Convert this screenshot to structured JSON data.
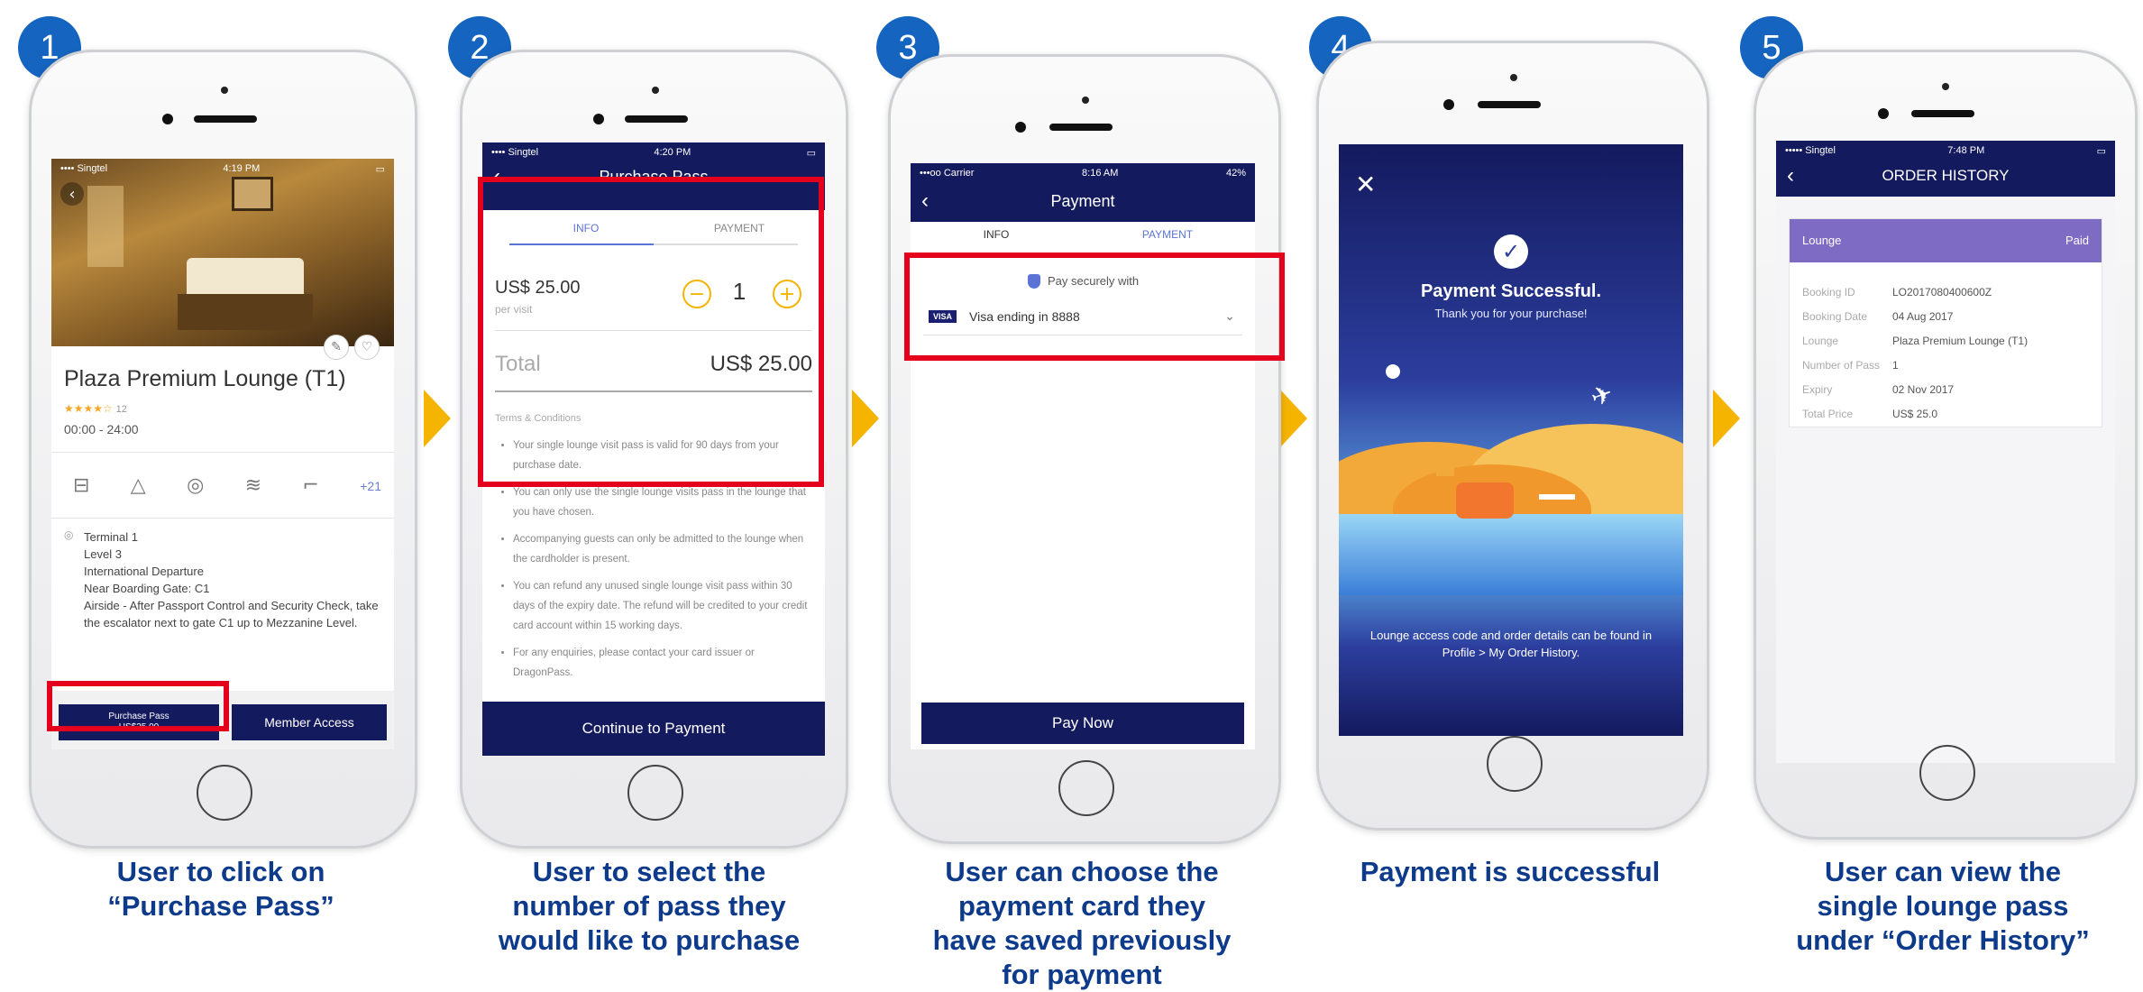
{
  "steps": [
    {
      "number": "1",
      "caption": [
        "User to click on",
        "“Purchase Pass”"
      ]
    },
    {
      "number": "2",
      "caption": [
        "User to select the",
        "number of pass they",
        "would like to purchase"
      ]
    },
    {
      "number": "3",
      "caption": [
        "User can choose the",
        "payment card they",
        "have saved previously",
        "for payment"
      ]
    },
    {
      "number": "4",
      "caption": [
        "Payment is successful"
      ]
    },
    {
      "number": "5",
      "caption": [
        "User can view the",
        "single lounge pass",
        "under “Order History”"
      ]
    }
  ],
  "screen1": {
    "status": {
      "carrier": "•••• Singtel",
      "time": "4:19 PM"
    },
    "lounge_name": "Plaza Premium Lounge (T1)",
    "rating_count": "12",
    "hours": "00:00 - 24:00",
    "amenities_more": "+21",
    "location_lines": [
      "Terminal 1",
      "Level 3",
      "International Departure",
      "Near Boarding Gate: C1",
      "Airside - After Passport Control and Security Check, take the escalator next to gate C1 up to Mezzanine Level."
    ],
    "purchase_label": "Purchase Pass",
    "purchase_price": "US$25.00",
    "member_label": "Member Access"
  },
  "screen2": {
    "status": {
      "carrier": "•••• Singtel",
      "time": "4:20 PM"
    },
    "title": "Purchase Pass",
    "tab_info": "INFO",
    "tab_payment": "PAYMENT",
    "price": "US$ 25.00",
    "per_visit": "per visit",
    "quantity": "1",
    "total_label": "Total",
    "total_value": "US$ 25.00",
    "terms_title": "Terms & Conditions",
    "terms": [
      "Your single lounge visit pass is valid for 90 days from your purchase date.",
      "You can only use the single lounge visits pass in the lounge that you have chosen.",
      "Accompanying guests can only be admitted to the lounge when the cardholder is present.",
      "You can refund any unused single lounge visit pass within 30 days of the expiry date. The refund will be credited to your credit card account within 15 working days.",
      "For any enquiries, please contact your card issuer or DragonPass."
    ],
    "continue_label": "Continue to Payment"
  },
  "screen3": {
    "status": {
      "carrier": "•••oo Carrier",
      "time": "8:16 AM",
      "battery": "42%"
    },
    "title": "Payment",
    "tab_info": "INFO",
    "tab_payment": "PAYMENT",
    "secure_label": "Pay securely with",
    "card_brand": "VISA",
    "card_label": "Visa ending in 8888",
    "pay_label": "Pay Now"
  },
  "screen4": {
    "title": "Payment Successful.",
    "subtitle": "Thank you for your purchase!",
    "footer": "Lounge access code and order details can be found in Profile > My Order History."
  },
  "screen5": {
    "status": {
      "carrier": "••••• Singtel",
      "time": "7:48 PM"
    },
    "title": "ORDER HISTORY",
    "card_header": "Lounge",
    "card_status": "Paid",
    "rows": [
      {
        "label": "Booking ID",
        "value": "LO2017080400600Z"
      },
      {
        "label": "Booking Date",
        "value": "04 Aug 2017"
      },
      {
        "label": "Lounge",
        "value": "Plaza Premium Lounge (T1)"
      },
      {
        "label": "Number of Pass",
        "value": "1"
      },
      {
        "label": "Expiry",
        "value": "02 Nov 2017"
      },
      {
        "label": "Total Price",
        "value": "US$ 25.0"
      }
    ]
  },
  "colors": {
    "brand_navy": "#141a5e",
    "badge_blue": "#1565c0",
    "arrow_yellow": "#f5b400",
    "highlight_red": "#e4001c",
    "caption_blue": "#0d3a8a",
    "header_purple": "#7e6bc4"
  }
}
